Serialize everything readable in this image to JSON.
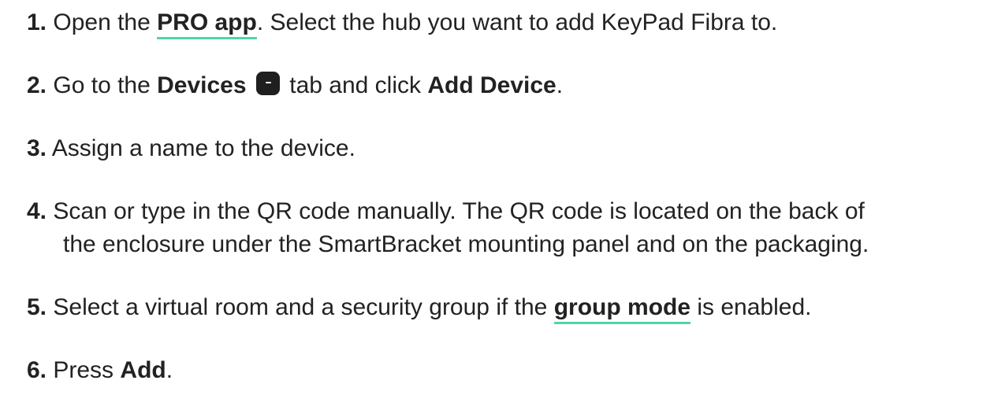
{
  "steps": [
    {
      "num": "1.",
      "pre": "Open the ",
      "link": "PRO app",
      "post": ". Select the hub you want to add KeyPad Fibra to."
    },
    {
      "num": "2.",
      "pre": "Go to the ",
      "bold1": "Devices",
      "icon": "devices-tab-icon",
      "mid": " tab and click ",
      "bold2": "Add Device",
      "post": "."
    },
    {
      "num": "3.",
      "text": "Assign a name to the device."
    },
    {
      "num": "4.",
      "line1": "Scan or type in the QR code manually. The QR code is located on the back of",
      "line2": "the enclosure under the SmartBracket mounting panel and on the packaging."
    },
    {
      "num": "5.",
      "pre": "Select a virtual room and a security group if the ",
      "link": "group mode",
      "post": " is enabled."
    },
    {
      "num": "6.",
      "pre": "Press ",
      "bold1": "Add",
      "post": "."
    }
  ],
  "colors": {
    "text": "#222222",
    "link_underline": "#4fd6a6",
    "icon_bg": "#1f1f1f"
  }
}
